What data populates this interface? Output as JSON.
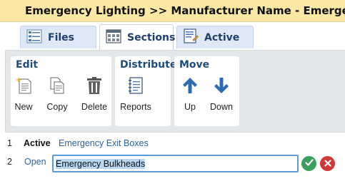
{
  "title": "Emergency Lighting >> Manufacturer Name - Emergency Lighting",
  "tabs": [
    {
      "label": "Files",
      "icon": "files-list-icon"
    },
    {
      "label": "Sections",
      "icon": "sections-grid-icon"
    },
    {
      "label": "Active",
      "icon": "active-document-icon"
    }
  ],
  "active_tab": "Sections",
  "ribbon": {
    "edit": {
      "title": "Edit",
      "new_label": "New",
      "copy_label": "Copy",
      "delete_label": "Delete"
    },
    "distribute": {
      "title": "Distribute",
      "reports_label": "Reports"
    },
    "move": {
      "title": "Move",
      "up_label": "Up",
      "down_label": "Down"
    }
  },
  "rows": [
    {
      "num": "1",
      "status": "Active",
      "name": "Emergency Exit Boxes"
    },
    {
      "num": "2",
      "status": "Open",
      "name": "Emergency Bulkheads"
    }
  ],
  "colors": {
    "title_bg": "#fbe8a4",
    "accent": "#1f3f6e",
    "link": "#2a63a5",
    "ok": "#3c9e5c",
    "cancel": "#cf3a38"
  }
}
